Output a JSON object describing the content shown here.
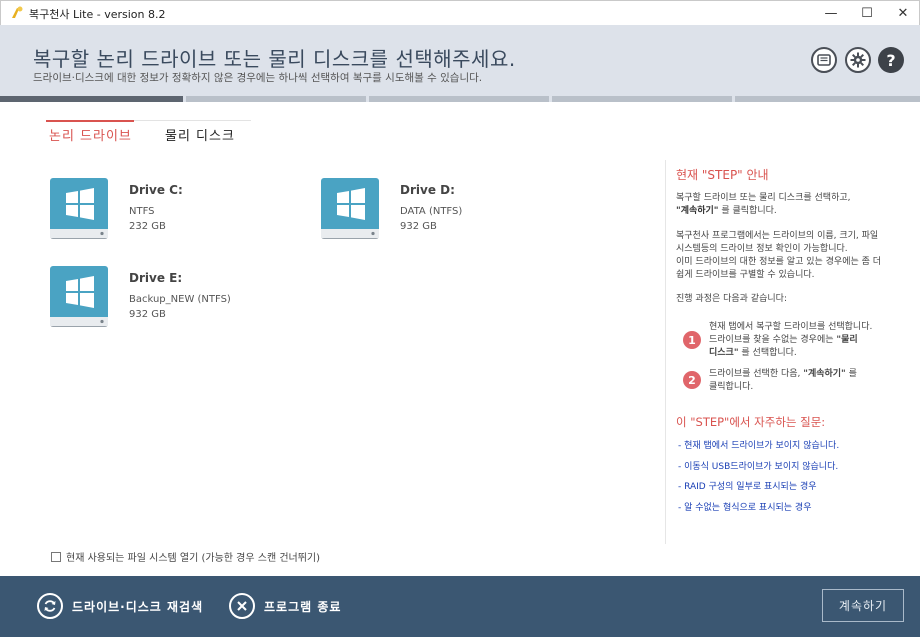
{
  "window": {
    "title": "복구천사 Lite - version 8.2",
    "minimize": "—",
    "maximize": "☐",
    "close": "✕"
  },
  "header": {
    "title": "복구할 논리 드라이브 또는 물리 디스크를 선택해주세요.",
    "subtitle": "드라이브·디스크에 대한 정보가 정확하지 않은 경우에는 하나씩 선택하여 복구를 시도해볼 수 있습니다.",
    "help_label": "?"
  },
  "tabs": {
    "logical": "논리 드라이브",
    "physical": "물리 디스크"
  },
  "drives": [
    {
      "name": "Drive C:",
      "fs": "NTFS",
      "size": "232 GB"
    },
    {
      "name": "Drive D:",
      "fs": "DATA (NTFS)",
      "size": "932 GB"
    },
    {
      "name": "Drive E:",
      "fs": "Backup_NEW (NTFS)",
      "size": "932 GB"
    }
  ],
  "checkbox": {
    "label": "현재 사용되는 파일 시스템 열기 (가능한 경우 스캔 건너뛰기)"
  },
  "guide": {
    "title": "현재 \"STEP\" 안내",
    "p1_line1": "복구할 드라이브 또는 물리 디스크를 선택하고,",
    "p1_bold": "\"계속하기\"",
    "p1_rest": " 를 클릭합니다.",
    "p2_line1": "복구천사 프로그램에서는 드라이브의 이름, 크기, 파일",
    "p2_line2": "시스템등의 드라이브 정보 확인이 가능합니다.",
    "p2_line3": "이미 드라이브의 대한 정보를 알고 있는 경우에는 좀 더",
    "p2_line4": "쉽게 드라이브를 구별할 수 있습니다.",
    "p3": "진행 과정은 다음과 같습니다:",
    "step1_num": "1",
    "step1_line1": "현재 탭에서 복구할 드라이브를 선택합니다.",
    "step1_line2": "드라이브를 찾을 수없는 경우에는",
    "step1_bold1": "\"물리",
    "step1_bold2": "디스크\"",
    "step1_rest": " 를 선택합니다.",
    "step2_num": "2",
    "step2_line1": "드라이브를 선택한 다음, ",
    "step2_bold": "\"계속하기\"",
    "step2_rest": " 를",
    "step2_line2": "클릭합니다.",
    "faq_title": "이 \"STEP\"에서 자주하는 질문:",
    "faqs": [
      "- 현재 탭에서 드라이브가 보이지 않습니다.",
      "- 이동식 USB드라이브가 보이지 않습니다.",
      "- RAID 구성의 일부로 표시되는 경우",
      "- 알 수없는 형식으로 표시되는 경우"
    ]
  },
  "footer": {
    "rescan": "드라이브·디스크 재검색",
    "exit": "프로그램 종료",
    "next": "계속하기"
  },
  "colors": {
    "accent": "#d9534f",
    "footer": "#3b5772",
    "header": "#dde2ea",
    "drive_icon": "#4aa3c3",
    "link": "#1a3fb5"
  }
}
